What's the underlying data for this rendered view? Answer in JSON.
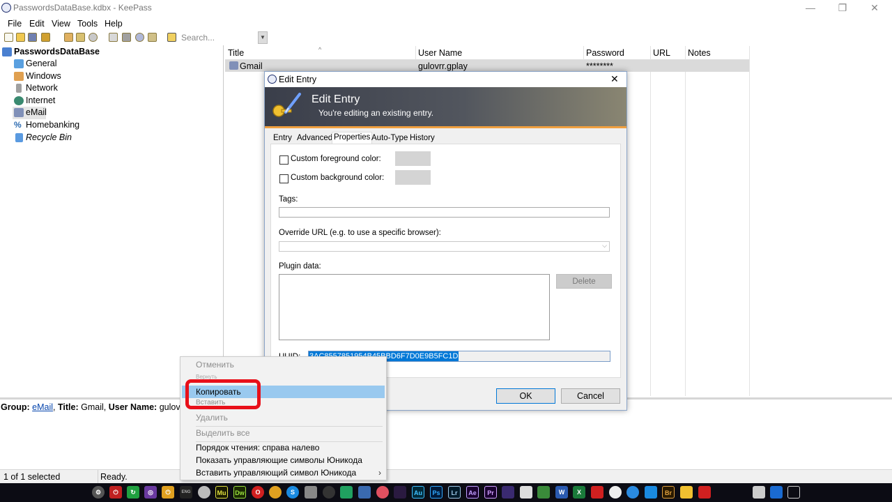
{
  "window": {
    "title": "PasswordsDataBase.kdbx - KeePass",
    "minimize": "—",
    "restore": "❐",
    "close": "✕"
  },
  "menu": [
    "File",
    "Edit",
    "View",
    "Tools",
    "Help"
  ],
  "toolbar": {
    "search_placeholder": "Search..."
  },
  "tree": {
    "root": "PasswordsDataBase",
    "items": [
      "General",
      "Windows",
      "Network",
      "Internet",
      "eMail",
      "Homebanking",
      "Recycle Bin"
    ],
    "selected": "eMail"
  },
  "list": {
    "columns": [
      "Title",
      "User Name",
      "Password",
      "URL",
      "Notes"
    ],
    "sort_indicator": "^",
    "rows": [
      {
        "title": "Gmail",
        "user_name": "gulovrr.gplay",
        "password": "********",
        "url": "",
        "notes": ""
      }
    ]
  },
  "dialog": {
    "title": "Edit Entry",
    "close": "✕",
    "banner_title": "Edit Entry",
    "banner_subtitle": "You're editing an existing entry.",
    "tabs": [
      "Entry",
      "Advanced",
      "Properties",
      "Auto-Type",
      "History"
    ],
    "active_tab": "Properties",
    "fg_color_label": "Custom foreground color:",
    "bg_color_label": "Custom background color:",
    "tags_label": "Tags:",
    "override_url_label": "Override URL (e.g. to use a specific browser):",
    "plugin_data_label": "Plugin data:",
    "delete_button": "Delete",
    "uuid_label": "UUID:",
    "uuid_value": "3AC8557851954B45BBD6F7D0E9B5FC1D",
    "ok_button": "OK",
    "cancel_button": "Cancel"
  },
  "detail": {
    "group_label": "Group:",
    "group_value": "eMail",
    "title_label": "Title:",
    "title_value": "Gmail,",
    "user_label": "User Name:",
    "user_value": "gulovrr."
  },
  "status": {
    "selection": "1 of 1 selected",
    "state": "Ready."
  },
  "context_menu": {
    "items": [
      {
        "label": "Отменить",
        "enabled": false
      },
      {
        "label": "Вернуть",
        "enabled": false
      },
      {
        "label": "Копировать",
        "enabled": true,
        "highlighted": true
      },
      {
        "label": "Вставить",
        "enabled": false
      },
      {
        "label": "Удалить",
        "enabled": false
      },
      {
        "label": "Выделить все",
        "enabled": false
      },
      {
        "label": "Порядок чтения: справа налево",
        "enabled": true
      },
      {
        "label": "Показать управляющие символы Юникода",
        "enabled": true
      },
      {
        "label": "Вставить управляющий символ Юникода",
        "enabled": true,
        "submenu": "›"
      }
    ]
  },
  "taskbar": {
    "apps": [
      "Mu",
      "Dw",
      "Au",
      "Ps",
      "Lr",
      "Ae",
      "Pr",
      "W",
      "X",
      "Br"
    ],
    "tray_clock": "ENG"
  },
  "colors": {
    "selection_blue": "#99c9ef",
    "uuid_select": "#0078d7",
    "highlight_red": "#e8101a"
  }
}
